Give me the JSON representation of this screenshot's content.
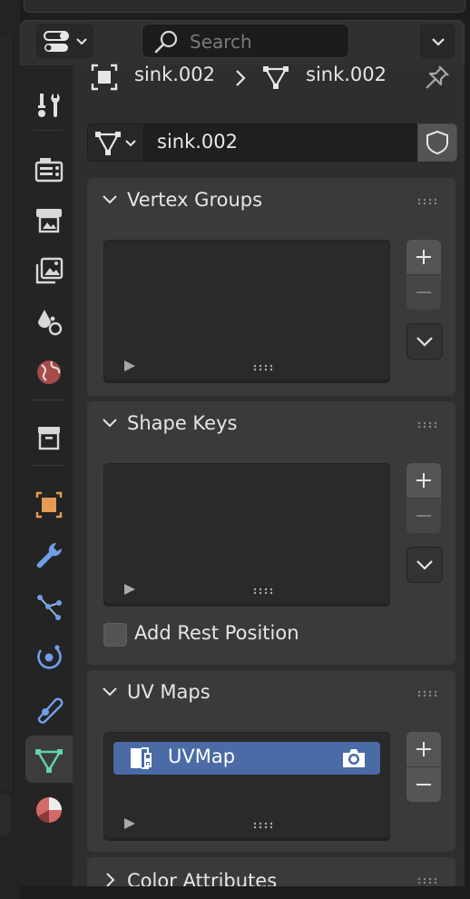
{
  "header": {
    "search_placeholder": "Search"
  },
  "tabs": [
    {
      "name": "tool-icon"
    },
    {
      "name": "render-icon"
    },
    {
      "name": "output-icon"
    },
    {
      "name": "view-layer-icon"
    },
    {
      "name": "scene-icon"
    },
    {
      "name": "world-icon"
    },
    {
      "name": "collection-icon"
    },
    {
      "name": "object-icon"
    },
    {
      "name": "modifiers-icon"
    },
    {
      "name": "particles-icon"
    },
    {
      "name": "physics-icon"
    },
    {
      "name": "constraints-icon"
    },
    {
      "name": "data-icon",
      "active": true
    },
    {
      "name": "material-icon"
    }
  ],
  "breadcrumb": {
    "object_name": "sink.002",
    "mesh_name": "sink.002"
  },
  "datablock": {
    "name": "sink.002"
  },
  "panels": {
    "vertex_groups": {
      "title": "Vertex Groups"
    },
    "shape_keys": {
      "title": "Shape Keys",
      "add_rest_position_label": "Add Rest Position",
      "add_rest_position": false
    },
    "uv_maps": {
      "title": "UV Maps",
      "items": [
        {
          "name": "UVMap",
          "selected": true
        }
      ]
    },
    "color_attributes": {
      "title": "Color Attributes"
    }
  },
  "colors": {
    "accent_selected": "#4b6ba6",
    "active_tab_icon": "#62d5a9",
    "object_icon": "#e39b55",
    "wrench_icon": "#6f9fe8",
    "material_icon": "#d36a6a"
  }
}
